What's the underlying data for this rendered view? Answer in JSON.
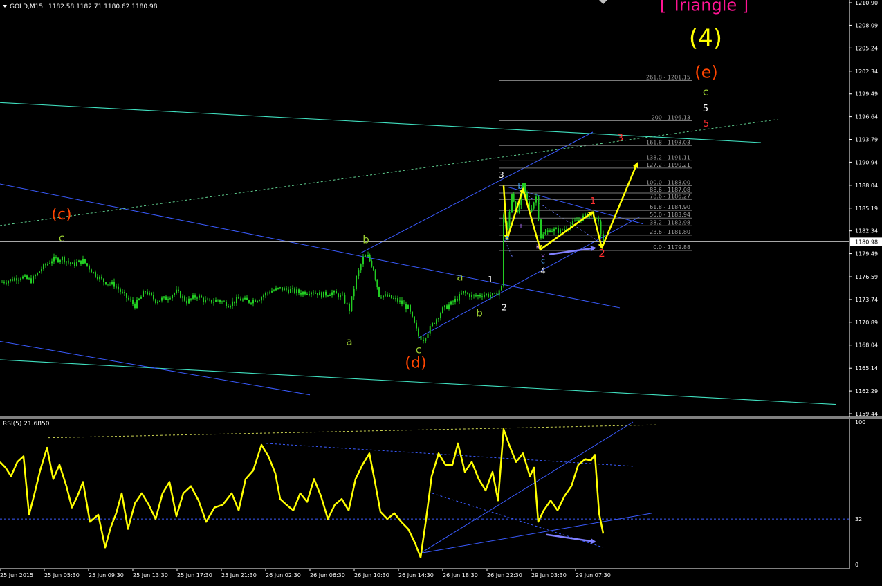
{
  "header": {
    "symbol_timeframe": "GOLD,M15",
    "ohlc": "1182.58 1182.71 1180.62 1180.98"
  },
  "rsi_header": "RSI(5) 21.6850",
  "colors": {
    "background": "#000000",
    "candle": "#22cc22",
    "rsi_line": "#ffff00",
    "channel_line": "#3a5bff",
    "cyan_line": "#40e0c0",
    "fib_line": "#7a7a7a",
    "arrow_yellow": "#ffff00",
    "arrow_violet": "#8080ff",
    "wave_orange": "#ff4500",
    "wave_green": "#9acd32",
    "triangle_pink": "#ff1493"
  },
  "chart_data": [
    {
      "type": "candlestick",
      "title": "GOLD,M15",
      "current_price": "1180.98",
      "y_ticks": [
        "1210.90",
        "1208.09",
        "1205.24",
        "1202.34",
        "1199.49",
        "1196.64",
        "1193.79",
        "1190.94",
        "1188.04",
        "1185.19",
        "1182.34",
        "1179.49",
        "1176.59",
        "1173.74",
        "1170.89",
        "1168.04",
        "1165.14",
        "1162.29",
        "1159.44"
      ],
      "ylim": [
        1159.44,
        1210.9
      ],
      "x_ticks": [
        "25 Jun 2015",
        "25 Jun 05:30",
        "25 Jun 09:30",
        "25 Jun 13:30",
        "25 Jun 17:30",
        "25 Jun 21:30",
        "26 Jun 02:30",
        "26 Jun 06:30",
        "26 Jun 10:30",
        "26 Jun 14:30",
        "26 Jun 18:30",
        "26 Jun 22:30",
        "29 Jun 03:30",
        "29 Jun 07:30"
      ],
      "close_path": [
        {
          "x": 0,
          "y": 1175.9
        },
        {
          "x": 15,
          "y": 1176.2
        },
        {
          "x": 30,
          "y": 1176.6
        },
        {
          "x": 45,
          "y": 1176.1
        },
        {
          "x": 60,
          "y": 1177.6
        },
        {
          "x": 75,
          "y": 1178.7
        },
        {
          "x": 90,
          "y": 1178.9
        },
        {
          "x": 105,
          "y": 1178.1
        },
        {
          "x": 120,
          "y": 1178.6
        },
        {
          "x": 135,
          "y": 1177.1
        },
        {
          "x": 150,
          "y": 1176.0
        },
        {
          "x": 165,
          "y": 1175.6
        },
        {
          "x": 180,
          "y": 1174.2
        },
        {
          "x": 195,
          "y": 1173.0
        },
        {
          "x": 210,
          "y": 1174.8
        },
        {
          "x": 225,
          "y": 1173.6
        },
        {
          "x": 240,
          "y": 1173.9
        },
        {
          "x": 255,
          "y": 1174.7
        },
        {
          "x": 270,
          "y": 1173.5
        },
        {
          "x": 285,
          "y": 1174.2
        },
        {
          "x": 300,
          "y": 1173.4
        },
        {
          "x": 315,
          "y": 1173.7
        },
        {
          "x": 330,
          "y": 1173.1
        },
        {
          "x": 345,
          "y": 1173.8
        },
        {
          "x": 360,
          "y": 1173.5
        },
        {
          "x": 375,
          "y": 1173.9
        },
        {
          "x": 390,
          "y": 1174.8
        },
        {
          "x": 405,
          "y": 1175.1
        },
        {
          "x": 420,
          "y": 1174.9
        },
        {
          "x": 435,
          "y": 1174.6
        },
        {
          "x": 450,
          "y": 1174.8
        },
        {
          "x": 465,
          "y": 1174.3
        },
        {
          "x": 480,
          "y": 1174.6
        },
        {
          "x": 495,
          "y": 1174.0
        },
        {
          "x": 505,
          "y": 1172.5
        },
        {
          "x": 515,
          "y": 1176.5
        },
        {
          "x": 525,
          "y": 1178.9
        },
        {
          "x": 532,
          "y": 1179.1
        },
        {
          "x": 540,
          "y": 1177.6
        },
        {
          "x": 548,
          "y": 1174.3
        },
        {
          "x": 560,
          "y": 1174.1
        },
        {
          "x": 575,
          "y": 1173.6
        },
        {
          "x": 590,
          "y": 1172.7
        },
        {
          "x": 605,
          "y": 1169.2
        },
        {
          "x": 612,
          "y": 1168.8
        },
        {
          "x": 625,
          "y": 1170.6
        },
        {
          "x": 640,
          "y": 1172.5
        },
        {
          "x": 655,
          "y": 1173.4
        },
        {
          "x": 670,
          "y": 1174.6
        },
        {
          "x": 685,
          "y": 1174.1
        },
        {
          "x": 700,
          "y": 1174.4
        },
        {
          "x": 715,
          "y": 1174.2
        },
        {
          "x": 725,
          "y": 1175.3
        },
        {
          "x": 728,
          "y": 1184.5
        },
        {
          "x": 733,
          "y": 1182.3
        },
        {
          "x": 740,
          "y": 1187.1
        },
        {
          "x": 748,
          "y": 1184.3
        },
        {
          "x": 756,
          "y": 1188.0
        },
        {
          "x": 765,
          "y": 1184.8
        },
        {
          "x": 775,
          "y": 1186.6
        },
        {
          "x": 782,
          "y": 1181.6
        },
        {
          "x": 795,
          "y": 1182.5
        },
        {
          "x": 810,
          "y": 1182.3
        },
        {
          "x": 825,
          "y": 1183.1
        },
        {
          "x": 840,
          "y": 1183.9
        },
        {
          "x": 855,
          "y": 1184.6
        },
        {
          "x": 865,
          "y": 1183.2
        },
        {
          "x": 872,
          "y": 1181.0
        }
      ],
      "fibonacci_levels": [
        {
          "ratio": "261.8",
          "price": "1201.15",
          "label": "261.8 - 1201.15"
        },
        {
          "ratio": "200",
          "price": "1196.13",
          "label": "200 - 1196.13"
        },
        {
          "ratio": "161.8",
          "price": "1193.03",
          "label": "161.8 - 1193.03"
        },
        {
          "ratio": "138.2",
          "price": "1191.11",
          "label": "138.2 - 1191.11"
        },
        {
          "ratio": "127.2",
          "price": "1190.21",
          "label": "127.2 - 1190.21"
        },
        {
          "ratio": "100.0",
          "price": "1188.00",
          "label": "100.0 - 1188.00"
        },
        {
          "ratio": "88.6",
          "price": "1187.08",
          "label": "88.6 - 1187.08"
        },
        {
          "ratio": "78.6",
          "price": "1186.27",
          "label": "78.6 - 1186.27"
        },
        {
          "ratio": "61.8",
          "price": "1184.90",
          "label": "61.8 - 1184.90"
        },
        {
          "ratio": "50.0",
          "price": "1183.94",
          "label": "50.0 - 1183.94"
        },
        {
          "ratio": "38.2",
          "price": "1182.98",
          "label": "38.2 - 1182.98"
        },
        {
          "ratio": "23.6",
          "price": "1181.80",
          "label": "23.6 - 1181.80"
        },
        {
          "ratio": "0.0",
          "price": "1179.88",
          "label": "0.0 - 1179.88"
        }
      ],
      "wave_labels": [
        {
          "text": "[ Triangle ]",
          "x": 1018,
          "price": 1209.9,
          "color": "#ff1493",
          "size": 24
        },
        {
          "text": "(4)",
          "x": 1020,
          "price": 1205.5,
          "color": "#ffff00",
          "size": 34
        },
        {
          "text": "(e)",
          "x": 1021,
          "price": 1201.5,
          "color": "#ff4500",
          "size": 24
        },
        {
          "text": "c",
          "x": 1020,
          "price": 1199.3,
          "color": "#9acd32",
          "size": 15
        },
        {
          "text": "5",
          "x": 1020,
          "price": 1197.3,
          "color": "#ffffff",
          "size": 13
        },
        {
          "text": "5",
          "x": 1021,
          "price": 1195.4,
          "color": "#ff3030",
          "size": 13
        },
        {
          "text": "3",
          "x": 897,
          "price": 1193.6,
          "color": "#ff3030",
          "size": 13
        },
        {
          "text": "3",
          "x": 725,
          "price": 1189.0,
          "color": "#ffffff",
          "size": 12
        },
        {
          "text": "b",
          "x": 752,
          "price": 1187.6,
          "color": "#4aa8ff",
          "size": 11
        },
        {
          "text": "ii",
          "x": 779,
          "price": 1186.0,
          "color": "#b070ff",
          "size": 10
        },
        {
          "text": "1",
          "x": 857,
          "price": 1185.7,
          "color": "#ff3030",
          "size": 13
        },
        {
          "text": "a",
          "x": 733,
          "price": 1181.2,
          "color": "#4aa8ff",
          "size": 11
        },
        {
          "text": "i",
          "x": 753,
          "price": 1182.7,
          "color": "#b070ff",
          "size": 10
        },
        {
          "text": "iii",
          "x": 776,
          "price": 1180.1,
          "color": "#b070ff",
          "size": 9
        },
        {
          "text": "v",
          "x": 785,
          "price": 1179.0,
          "color": "#b070ff",
          "size": 9
        },
        {
          "text": "c",
          "x": 785,
          "price": 1178.3,
          "color": "#4aa8ff",
          "size": 11
        },
        {
          "text": "4",
          "x": 785,
          "price": 1177.0,
          "color": "#ffffff",
          "size": 12
        },
        {
          "text": "2",
          "x": 870,
          "price": 1179.1,
          "color": "#ff3030",
          "size": 15
        },
        {
          "text": "(c)",
          "x": 89,
          "price": 1183.8,
          "color": "#ff4500",
          "size": 22
        },
        {
          "text": "c",
          "x": 89,
          "price": 1181.0,
          "color": "#9acd32",
          "size": 15
        },
        {
          "text": "b",
          "x": 529,
          "price": 1180.8,
          "color": "#9acd32",
          "size": 15
        },
        {
          "text": "a",
          "x": 665,
          "price": 1176.1,
          "color": "#9acd32",
          "size": 15
        },
        {
          "text": "1",
          "x": 709,
          "price": 1175.9,
          "color": "#ffffff",
          "size": 12
        },
        {
          "text": "2",
          "x": 729,
          "price": 1172.4,
          "color": "#ffffff",
          "size": 12
        },
        {
          "text": "b",
          "x": 693,
          "price": 1171.6,
          "color": "#9acd32",
          "size": 15
        },
        {
          "text": "a",
          "x": 505,
          "price": 1168.0,
          "color": "#9acd32",
          "size": 15
        },
        {
          "text": "c",
          "x": 605,
          "price": 1167.0,
          "color": "#9acd32",
          "size": 15
        },
        {
          "text": "(d)",
          "x": 601,
          "price": 1165.2,
          "color": "#ff4500",
          "size": 22
        }
      ]
    },
    {
      "type": "line",
      "title": "RSI(5) 21.6850",
      "ylim": [
        0,
        100
      ],
      "y_ticks": [
        "100",
        "32",
        "0"
      ],
      "level": 32,
      "series": [
        {
          "values": [
            {
              "x": 0,
              "y": 72
            },
            {
              "x": 8,
              "y": 68
            },
            {
              "x": 16,
              "y": 62
            },
            {
              "x": 25,
              "y": 72
            },
            {
              "x": 34,
              "y": 76
            },
            {
              "x": 42,
              "y": 35
            },
            {
              "x": 50,
              "y": 50
            },
            {
              "x": 58,
              "y": 66
            },
            {
              "x": 68,
              "y": 82
            },
            {
              "x": 77,
              "y": 60
            },
            {
              "x": 86,
              "y": 70
            },
            {
              "x": 96,
              "y": 55
            },
            {
              "x": 104,
              "y": 40
            },
            {
              "x": 112,
              "y": 48
            },
            {
              "x": 120,
              "y": 58
            },
            {
              "x": 130,
              "y": 30
            },
            {
              "x": 142,
              "y": 35
            },
            {
              "x": 152,
              "y": 12
            },
            {
              "x": 160,
              "y": 26
            },
            {
              "x": 168,
              "y": 36
            },
            {
              "x": 176,
              "y": 50
            },
            {
              "x": 185,
              "y": 25
            },
            {
              "x": 195,
              "y": 43
            },
            {
              "x": 205,
              "y": 50
            },
            {
              "x": 215,
              "y": 42
            },
            {
              "x": 225,
              "y": 32
            },
            {
              "x": 235,
              "y": 50
            },
            {
              "x": 245,
              "y": 58
            },
            {
              "x": 255,
              "y": 34
            },
            {
              "x": 265,
              "y": 50
            },
            {
              "x": 276,
              "y": 55
            },
            {
              "x": 287,
              "y": 45
            },
            {
              "x": 298,
              "y": 30
            },
            {
              "x": 310,
              "y": 40
            },
            {
              "x": 322,
              "y": 42
            },
            {
              "x": 335,
              "y": 50
            },
            {
              "x": 345,
              "y": 38
            },
            {
              "x": 355,
              "y": 60
            },
            {
              "x": 366,
              "y": 66
            },
            {
              "x": 378,
              "y": 84
            },
            {
              "x": 388,
              "y": 76
            },
            {
              "x": 398,
              "y": 64
            },
            {
              "x": 405,
              "y": 46
            },
            {
              "x": 414,
              "y": 42
            },
            {
              "x": 424,
              "y": 38
            },
            {
              "x": 434,
              "y": 50
            },
            {
              "x": 444,
              "y": 44
            },
            {
              "x": 454,
              "y": 60
            },
            {
              "x": 464,
              "y": 48
            },
            {
              "x": 474,
              "y": 32
            },
            {
              "x": 484,
              "y": 42
            },
            {
              "x": 494,
              "y": 46
            },
            {
              "x": 504,
              "y": 38
            },
            {
              "x": 514,
              "y": 60
            },
            {
              "x": 524,
              "y": 70
            },
            {
              "x": 534,
              "y": 78
            },
            {
              "x": 542,
              "y": 58
            },
            {
              "x": 550,
              "y": 37
            },
            {
              "x": 560,
              "y": 32
            },
            {
              "x": 570,
              "y": 36
            },
            {
              "x": 580,
              "y": 30
            },
            {
              "x": 590,
              "y": 25
            },
            {
              "x": 600,
              "y": 15
            },
            {
              "x": 608,
              "y": 5
            },
            {
              "x": 616,
              "y": 32
            },
            {
              "x": 624,
              "y": 62
            },
            {
              "x": 634,
              "y": 78
            },
            {
              "x": 644,
              "y": 70
            },
            {
              "x": 654,
              "y": 70
            },
            {
              "x": 662,
              "y": 85
            },
            {
              "x": 672,
              "y": 65
            },
            {
              "x": 682,
              "y": 72
            },
            {
              "x": 692,
              "y": 60
            },
            {
              "x": 702,
              "y": 52
            },
            {
              "x": 712,
              "y": 65
            },
            {
              "x": 720,
              "y": 45
            },
            {
              "x": 728,
              "y": 95
            },
            {
              "x": 736,
              "y": 84
            },
            {
              "x": 746,
              "y": 72
            },
            {
              "x": 756,
              "y": 78
            },
            {
              "x": 766,
              "y": 62
            },
            {
              "x": 772,
              "y": 68
            },
            {
              "x": 778,
              "y": 30
            },
            {
              "x": 786,
              "y": 38
            },
            {
              "x": 796,
              "y": 45
            },
            {
              "x": 806,
              "y": 38
            },
            {
              "x": 816,
              "y": 48
            },
            {
              "x": 826,
              "y": 55
            },
            {
              "x": 836,
              "y": 70
            },
            {
              "x": 846,
              "y": 74
            },
            {
              "x": 854,
              "y": 73
            },
            {
              "x": 860,
              "y": 77
            },
            {
              "x": 866,
              "y": 36
            },
            {
              "x": 872,
              "y": 21.685
            }
          ]
        }
      ]
    }
  ]
}
